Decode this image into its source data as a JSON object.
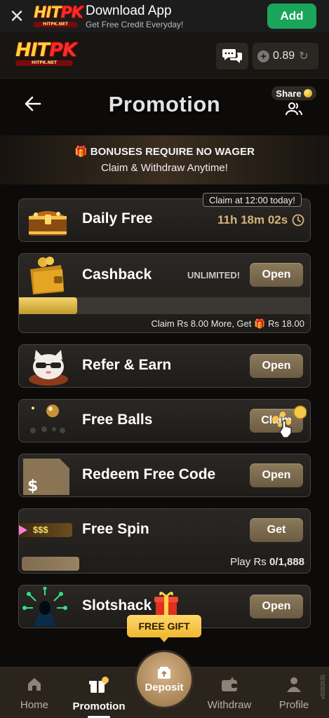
{
  "download_bar": {
    "title": "Download App",
    "subtitle": "Get Free Credit Everyday!",
    "add_label": "Add",
    "close_icon": "close-icon"
  },
  "brand": {
    "logo_main": "HIT",
    "logo_accent": "PK",
    "logo_sub": "HITPK.NET"
  },
  "header": {
    "balance": "0.89"
  },
  "page": {
    "title": "Promotion",
    "share_label": "Share"
  },
  "bonus_note": {
    "line1": "BONUSES REQUIRE NO WAGER",
    "line2": "Claim & Withdraw Anytime!"
  },
  "promotions": {
    "daily_free": {
      "title": "Daily Free",
      "claim_tag": "Claim at 12:00 today!",
      "timer": "11h 18m 02s"
    },
    "cashback": {
      "title": "Cashback",
      "badge": "UNLIMITED!",
      "button": "Open",
      "progress_fraction": 0.2,
      "footer_prefix": "Claim Rs 8.00 More, Get",
      "footer_suffix": "Rs 18.00"
    },
    "refer": {
      "title": "Refer & Earn",
      "button": "Open"
    },
    "free_balls": {
      "title": "Free Balls",
      "button": "Claim"
    },
    "redeem": {
      "title": "Redeem Free Code",
      "button": "Open"
    },
    "free_spin": {
      "title": "Free Spin",
      "button": "Get",
      "thumb_text": "$$$",
      "footer_prefix": "Play Rs ",
      "footer_value": "0/1,888"
    },
    "slotshack": {
      "title": "Slotshack",
      "button": "Open"
    }
  },
  "free_gift_label": "FREE GIFT",
  "nav": {
    "home": "Home",
    "promotion": "Promotion",
    "deposit": "Deposit",
    "withdraw": "Withdraw",
    "profile": "Profile"
  },
  "side_code": "v9282635",
  "colors": {
    "accent_green": "#19a55a",
    "gold": "#d6b37a",
    "button": "#7d6b4e"
  }
}
